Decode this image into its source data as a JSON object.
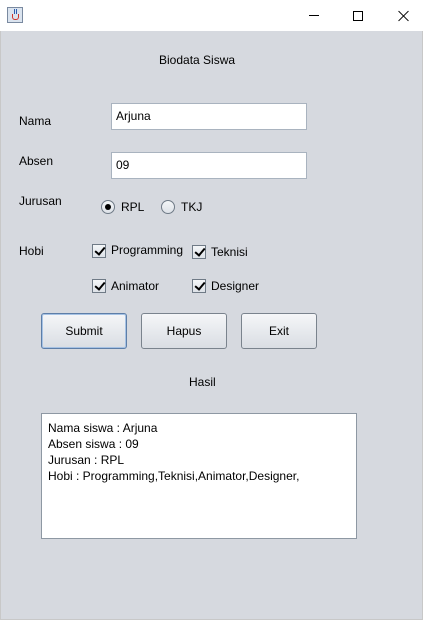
{
  "window": {
    "icon": "java-cup-icon",
    "controls": {
      "minimize": "minimize-icon",
      "maximize": "maximize-icon",
      "close": "close-icon"
    }
  },
  "form": {
    "title": "Biodata Siswa",
    "nama": {
      "label": "Nama",
      "value": "Arjuna"
    },
    "absen": {
      "label": "Absen",
      "value": "09"
    },
    "jurusan": {
      "label": "Jurusan",
      "options": [
        {
          "label": "RPL",
          "selected": true
        },
        {
          "label": "TKJ",
          "selected": false
        }
      ]
    },
    "hobi": {
      "label": "Hobi",
      "options": [
        {
          "label": "Programming",
          "checked": true
        },
        {
          "label": "Teknisi",
          "checked": true
        },
        {
          "label": "Animator",
          "checked": true
        },
        {
          "label": "Designer",
          "checked": true
        }
      ]
    },
    "buttons": {
      "submit": "Submit",
      "hapus": "Hapus",
      "exit": "Exit"
    }
  },
  "result": {
    "title": "Hasil",
    "lines": [
      "Nama siswa : Arjuna",
      "Absen siswa : 09",
      "Jurusan : RPL",
      "Hobi : Programming,Teknisi,Animator,Designer,"
    ]
  }
}
